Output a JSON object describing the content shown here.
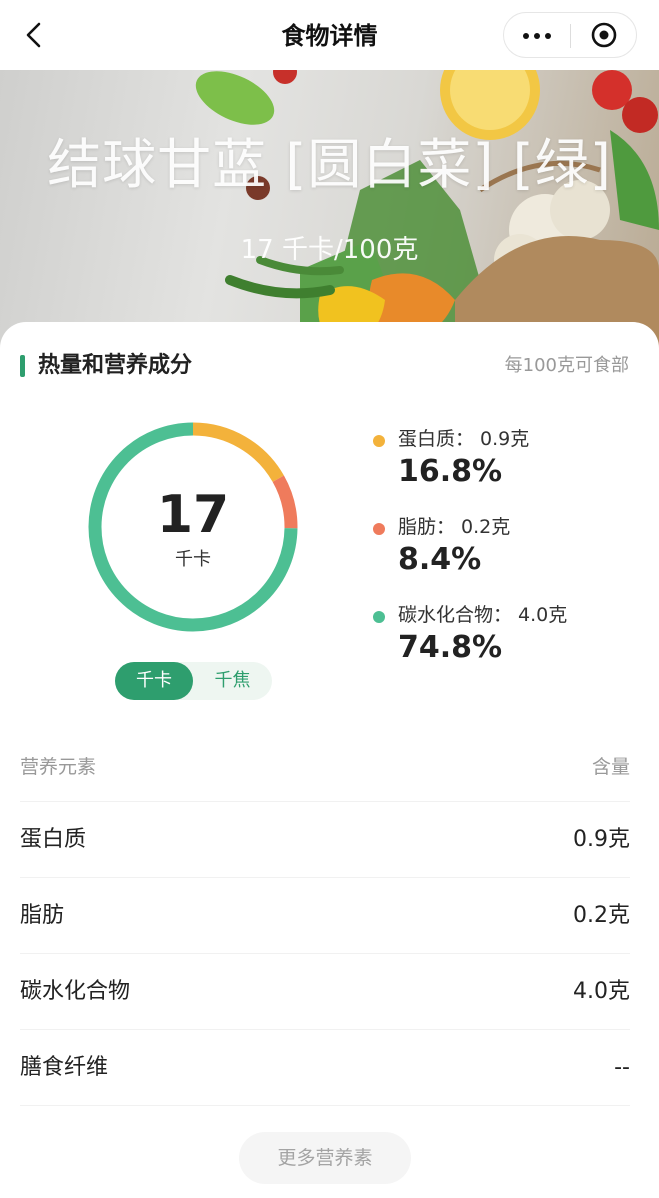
{
  "navbar": {
    "title": "食物详情",
    "back_icon": "chevron-left-icon",
    "more_icon": "more-dots-icon",
    "close_icon": "target-circle-icon"
  },
  "hero": {
    "food_name": "结球甘蓝 [圆白菜] [绿]",
    "calories_per_100g": "17 千卡/100克"
  },
  "nutrition": {
    "section_title": "热量和营养成分",
    "basis_note": "每100克可食部",
    "total_value": "17",
    "total_unit": "千卡",
    "unit_toggle": {
      "active": "千卡",
      "inactive": "千焦"
    },
    "macros": [
      {
        "label": "蛋白质： 0.9克",
        "percent": "16.8%",
        "fraction": 0.168,
        "color": "#f3b23b"
      },
      {
        "label": "脂肪： 0.2克",
        "percent": "8.4%",
        "fraction": 0.084,
        "color": "#ef7b5c"
      },
      {
        "label": "碳水化合物： 4.0克",
        "percent": "74.8%",
        "fraction": 0.748,
        "color": "#4dbf93"
      }
    ]
  },
  "table": {
    "header": {
      "name": "营养元素",
      "amount": "含量"
    },
    "rows": [
      {
        "name": "蛋白质",
        "amount": "0.9克"
      },
      {
        "name": "脂肪",
        "amount": "0.2克"
      },
      {
        "name": "碳水化合物",
        "amount": "4.0克"
      },
      {
        "name": "膳食纤维",
        "amount": "--"
      }
    ]
  },
  "more_button": "更多营养素",
  "colors": {
    "accent": "#2e9e6e"
  }
}
